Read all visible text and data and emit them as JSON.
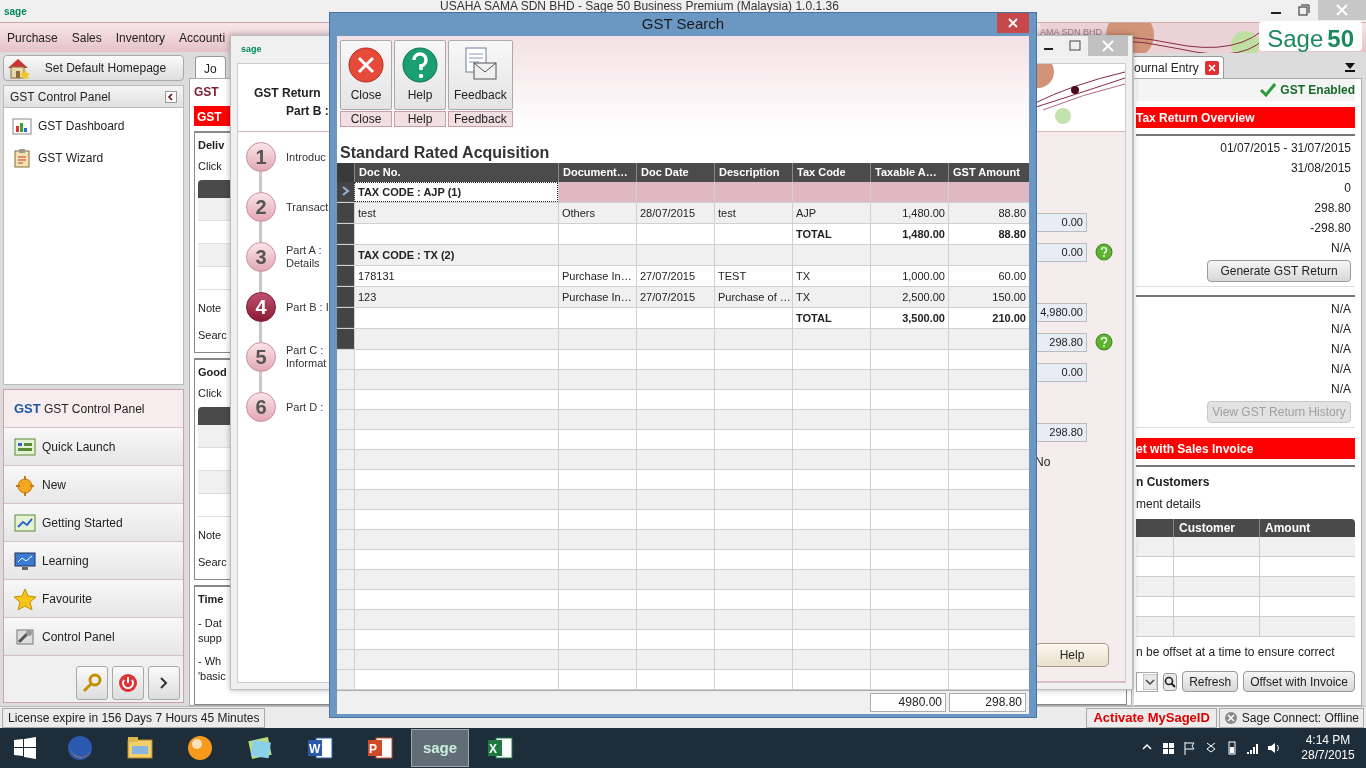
{
  "app": {
    "title": "USAHA SAMA SDN BHD - Sage 50 Business Premium (Malaysia) 1.0.1.36",
    "logo": "sage",
    "brand": "Sage",
    "brand_number": "50",
    "banner_text": "AMA SDN BHD"
  },
  "menu": [
    "Purchase",
    "Sales",
    "Inventory",
    "Accounti"
  ],
  "sidebar": {
    "home_button": "Set Default Homepage",
    "panel_title": "GST Control Panel",
    "items": [
      "GST Dashboard",
      "GST Wizard"
    ],
    "nav": [
      {
        "label": "GST Control Panel",
        "badge": "GST",
        "selected": true
      },
      {
        "label": "Quick Launch",
        "selected": false
      },
      {
        "label": "New",
        "selected": false
      },
      {
        "label": "Getting Started",
        "selected": false
      },
      {
        "label": "Learning",
        "selected": false
      },
      {
        "label": "Favourite",
        "selected": false
      },
      {
        "label": "Control Panel",
        "selected": false
      }
    ]
  },
  "main_strip": {
    "tab": "Jo",
    "title": "GST",
    "red_header": "GST",
    "sections": [
      {
        "kind": "grid",
        "title": "Deliv",
        "intro": "Click",
        "notes": [
          "Note",
          "Searc"
        ]
      },
      {
        "kind": "grid",
        "title": "Good",
        "intro": "Click",
        "notes": [
          "Note",
          "Searc"
        ]
      },
      {
        "kind": "text",
        "title": "Time",
        "paragraphs": [
          [
            "- Dat",
            "supp"
          ],
          [
            "- Wh",
            "'basic"
          ]
        ]
      }
    ]
  },
  "part_b_window": {
    "logo": "sage",
    "title": "GST Return",
    "subtitle": "Part B :",
    "steps": [
      {
        "number": "1",
        "lines": [
          "Introduc"
        ],
        "selected": false
      },
      {
        "number": "2",
        "lines": [
          "Transact"
        ],
        "selected": false
      },
      {
        "number": "3",
        "lines": [
          "Part A :",
          "Details"
        ],
        "selected": false
      },
      {
        "number": "4",
        "lines": [
          "Part B : I"
        ],
        "selected": true
      },
      {
        "number": "5",
        "lines": [
          "Part C :",
          "Informat"
        ],
        "selected": false
      },
      {
        "number": "6",
        "lines": [
          "Part D :"
        ],
        "selected": false
      }
    ],
    "fields": [
      {
        "kind": "field",
        "value": "0.00",
        "help": false
      },
      {
        "kind": "field",
        "value": "0.00",
        "help": true
      },
      {
        "kind": "blank"
      },
      {
        "kind": "field",
        "value": "4,980.00",
        "help": false
      },
      {
        "kind": "field",
        "value": "298.80",
        "help": true
      },
      {
        "kind": "field",
        "value": "0.00",
        "help": false
      },
      {
        "kind": "blank"
      },
      {
        "kind": "field",
        "value": "298.80",
        "help": false
      },
      {
        "kind": "text",
        "value": "No"
      }
    ],
    "help_button": "Help"
  },
  "right_panel": {
    "tab": "ournal Entry",
    "status": "GST Enabled",
    "overview_header": "Tax Return Overview",
    "overview_values": [
      "01/07/2015 - 31/07/2015",
      "31/08/2015",
      "0",
      "298.80",
      "-298.80",
      "N/A"
    ],
    "generate_button": "Generate GST Return",
    "history_values": [
      "N/A",
      "N/A",
      "N/A",
      "N/A",
      "N/A"
    ],
    "history_button": {
      "label": "View GST Return History",
      "disabled": true
    },
    "offset_header": "et with Sales Invoice",
    "offset_title": "n Customers",
    "offset_subtitle": "ment details",
    "offset_columns": [
      "Customer",
      "Amount"
    ],
    "offset_note": "n be offset at a time to ensure correct",
    "offset_buttons": [
      "Refresh",
      "Offset with Invoice"
    ]
  },
  "dialog": {
    "title": "GST Search",
    "tools": [
      {
        "label": "Close",
        "group": "Close"
      },
      {
        "label": "Help",
        "group": "Help"
      },
      {
        "label": "Feedback",
        "group": "Feedback"
      }
    ],
    "heading": "Standard Rated Acquisition",
    "columns": [
      "Doc No.",
      "Document…",
      "Doc Date",
      "Description",
      "Tax Code",
      "Taxable A…",
      "GST Amount"
    ],
    "rows": [
      {
        "kind": "group",
        "label": "TAX CODE : AJP (1)",
        "selected": true
      },
      {
        "kind": "data",
        "cells": [
          "test",
          "Others",
          "28/07/2015",
          "test",
          "AJP",
          "1,480.00",
          "88.80"
        ],
        "selected": false
      },
      {
        "kind": "total",
        "label": "TOTAL",
        "taxable": "1,480.00",
        "gst": "88.80",
        "selected": false
      },
      {
        "kind": "group",
        "label": "TAX CODE : TX (2)",
        "selected": false
      },
      {
        "kind": "data",
        "cells": [
          "178131",
          "Purchase In…",
          "27/07/2015",
          "TEST",
          "TX",
          "1,000.00",
          "60.00"
        ],
        "selected": false
      },
      {
        "kind": "data",
        "cells": [
          "123",
          "Purchase In…",
          "27/07/2015",
          "Purchase of …",
          "TX",
          "2,500.00",
          "150.00"
        ],
        "selected": false
      },
      {
        "kind": "total",
        "label": "TOTAL",
        "taxable": "3,500.00",
        "gst": "210.00",
        "selected": false
      },
      {
        "kind": "blank",
        "selected": false
      }
    ],
    "footer": {
      "taxable": "4980.00",
      "gst": "298.80"
    }
  },
  "status_bar": {
    "license": "License expire in 156 Days 7 Hours 45 Minutes",
    "activate": "Activate MySageID",
    "connect": "Sage Connect: Offline"
  },
  "taskbar": {
    "apps": [
      {
        "kind": "firefox",
        "selected": false
      },
      {
        "kind": "explorer",
        "selected": false
      },
      {
        "kind": "orb",
        "selected": false
      },
      {
        "kind": "photos",
        "selected": false
      },
      {
        "kind": "word",
        "label": "W",
        "selected": false
      },
      {
        "kind": "powerpoint",
        "label": "P",
        "selected": false
      },
      {
        "kind": "sage",
        "label": "sage",
        "selected": true
      },
      {
        "kind": "excel",
        "label": "X",
        "selected": false
      }
    ],
    "time": "4:14 PM",
    "date": "28/7/2015"
  }
}
